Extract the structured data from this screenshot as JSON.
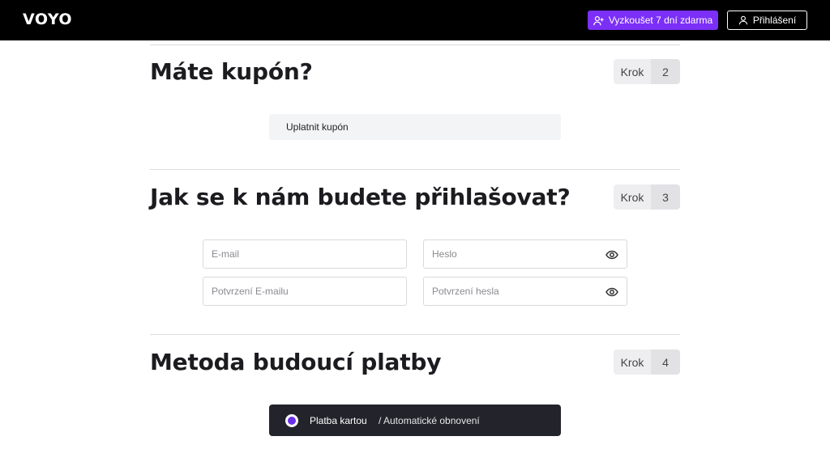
{
  "header": {
    "logo": "VOYO",
    "trial_button": "Vyzkoušet 7 dní zdarma",
    "login_button": "Přihlášení"
  },
  "sections": [
    {
      "title": "Máte kupón?",
      "step_label": "Krok",
      "step_number": "2"
    },
    {
      "title": "Jak se k nám budete přihlašovat?",
      "step_label": "Krok",
      "step_number": "3"
    },
    {
      "title": "Metoda budoucí platby",
      "step_label": "Krok",
      "step_number": "4"
    }
  ],
  "coupon": {
    "label": "Uplatnit kupón"
  },
  "login_form": {
    "email_placeholder": "E-mail",
    "password_placeholder": "Heslo",
    "email_confirm_placeholder": "Potvrzení E-mailu",
    "password_confirm_placeholder": "Potvrzení hesla"
  },
  "payment": {
    "option_label": "Platba kartou",
    "option_sub": "/ Automatické obnovení",
    "selected": true
  },
  "colors": {
    "accent": "#7b2ff7",
    "header_bg": "#000000",
    "payment_bg": "#23232b"
  },
  "icons": {
    "trial": "add-user-icon",
    "login": "user-icon",
    "password_toggle": "eye-icon"
  }
}
